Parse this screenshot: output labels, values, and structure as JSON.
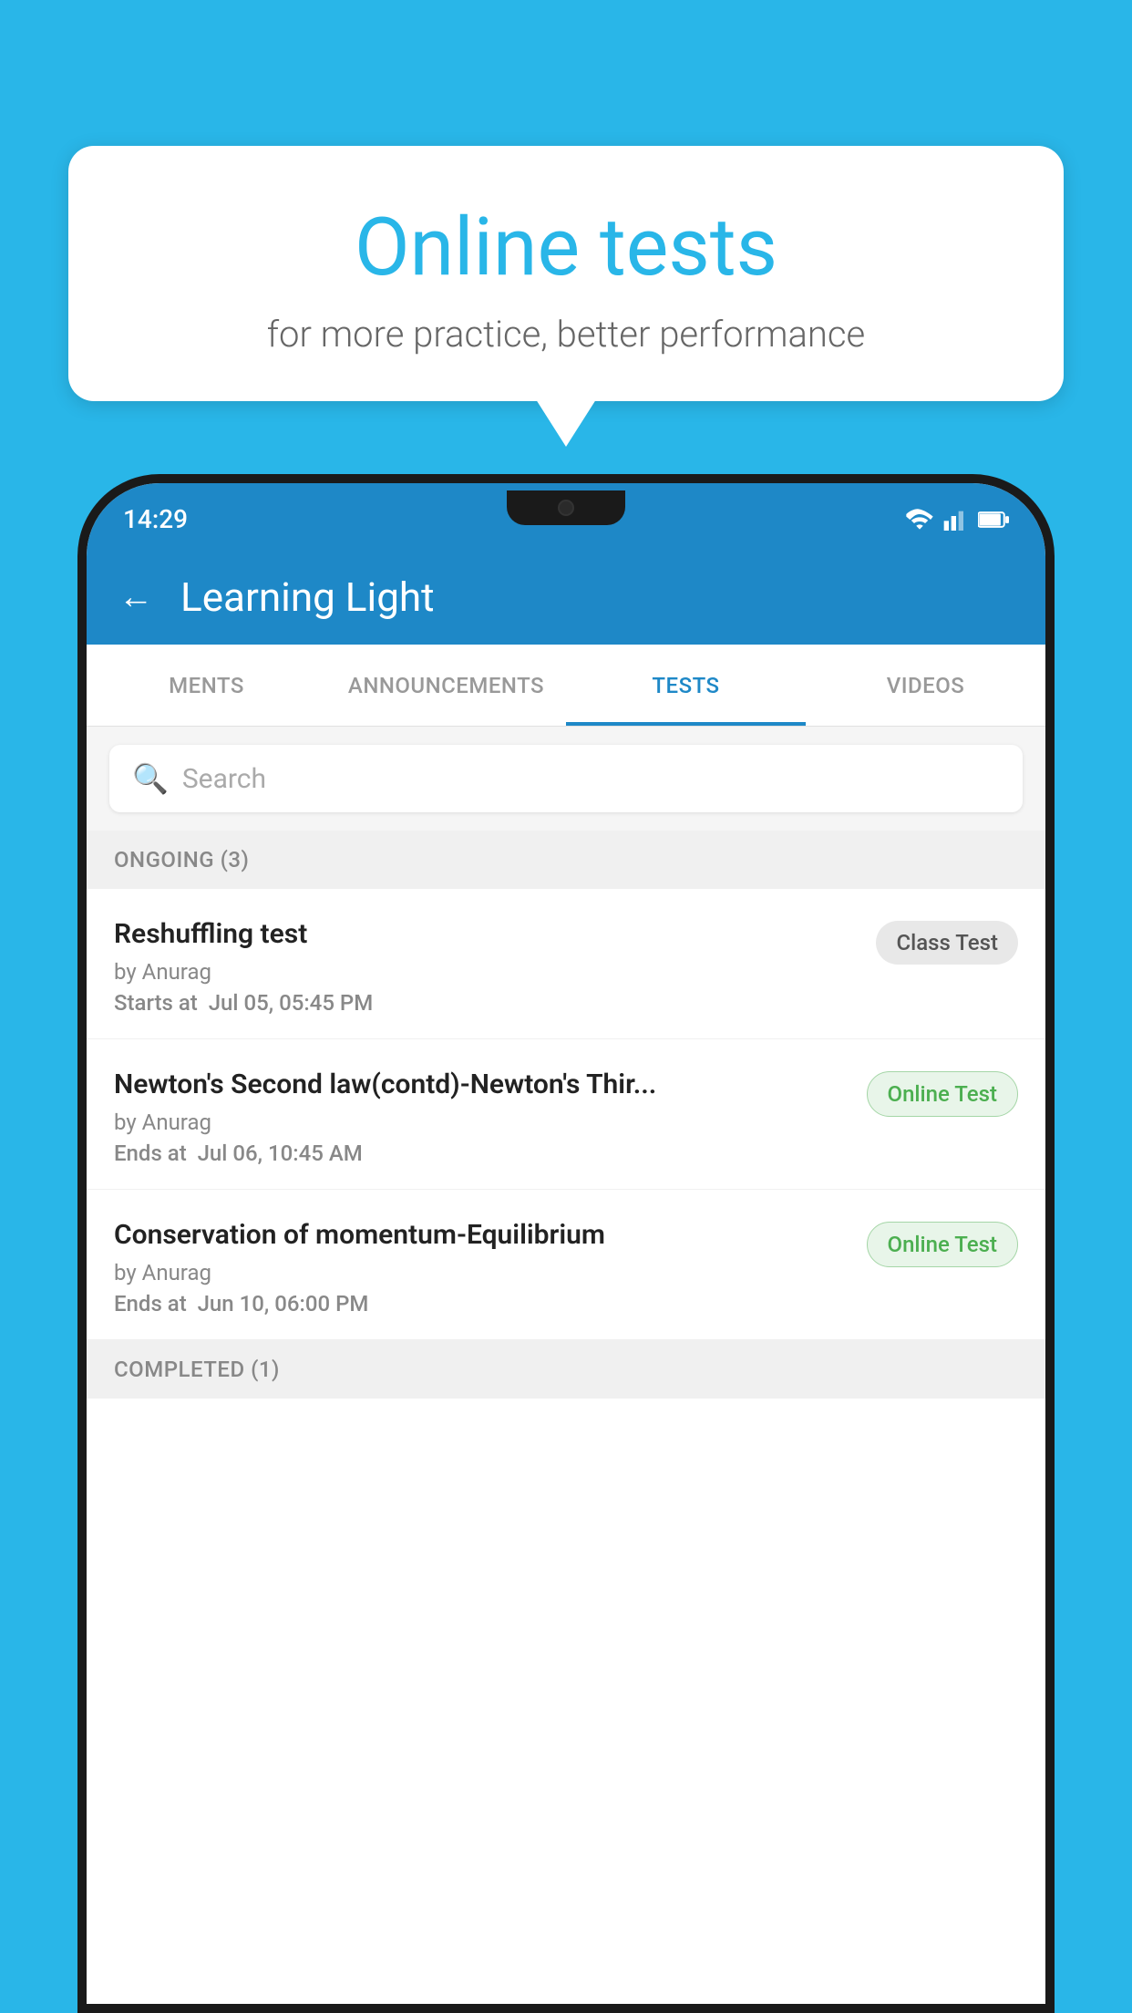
{
  "background_color": "#29b6e8",
  "speech_bubble": {
    "title": "Online tests",
    "subtitle": "for more practice, better performance"
  },
  "status_bar": {
    "time": "14:29"
  },
  "app_bar": {
    "title": "Learning Light",
    "back_label": "←"
  },
  "tabs": [
    {
      "label": "MENTS",
      "active": false
    },
    {
      "label": "ANNOUNCEMENTS",
      "active": false
    },
    {
      "label": "TESTS",
      "active": true
    },
    {
      "label": "VIDEOS",
      "active": false
    }
  ],
  "search": {
    "placeholder": "Search"
  },
  "ongoing_section": {
    "label": "ONGOING (3)"
  },
  "tests": [
    {
      "title": "Reshuffling test",
      "author": "by Anurag",
      "date_label": "Starts at",
      "date": "Jul 05, 05:45 PM",
      "badge": "Class Test",
      "badge_type": "class"
    },
    {
      "title": "Newton's Second law(contd)-Newton's Thir...",
      "author": "by Anurag",
      "date_label": "Ends at",
      "date": "Jul 06, 10:45 AM",
      "badge": "Online Test",
      "badge_type": "online"
    },
    {
      "title": "Conservation of momentum-Equilibrium",
      "author": "by Anurag",
      "date_label": "Ends at",
      "date": "Jun 10, 06:00 PM",
      "badge": "Online Test",
      "badge_type": "online"
    }
  ],
  "completed_section": {
    "label": "COMPLETED (1)"
  }
}
